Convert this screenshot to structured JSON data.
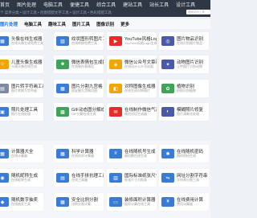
{
  "nav": {
    "menu": [
      "首页",
      "图片处理",
      "电脑工具",
      "便捷工具",
      "综合工具",
      "建站工具",
      "站长工具",
      "设计工具"
    ],
    "breadcrumbs": "个 菜单分类  • 设计工具  • 创意搭配文字工具 • 设计工具 • 色彩搭配工具",
    "search_placeholder": "搜索站内工具"
  },
  "tabs": [
    "图片处理",
    "电脑工具",
    "趣味工具",
    "图片工具",
    "图像识别",
    "更多"
  ],
  "row1": [
    {
      "title": "头像在线生成器",
      "desc": "在线头像生成免费工具",
      "color": "#3a7bd5",
      "icon": "▦"
    },
    {
      "title": "纹状图形转图片工具",
      "desc": "在线转换免费工具",
      "color": "#3a7bd5",
      "icon": "▧"
    },
    {
      "title": "YouTube风格Logo生成",
      "desc": "YouTube风格Logo生成",
      "color": "#e52d27",
      "icon": "▶"
    },
    {
      "title": "图片物品识别",
      "desc": "在线识别图片物品",
      "color": "#4a5aa8",
      "icon": "◎"
    }
  ],
  "row2": [
    {
      "title": "儿童头像生成器",
      "desc": "卡通头像在线生成",
      "color": "#f0a500",
      "icon": "☺"
    },
    {
      "title": "微信表情包生成器",
      "desc": "在线制作表情包",
      "color": "#3fa35a",
      "icon": "☻"
    },
    {
      "title": "微信公众号文章封面",
      "desc": "在线设计公众号封面",
      "color": "#f0a500",
      "icon": "◈"
    },
    {
      "title": "动物图片识别",
      "desc": "上传图片识别动物",
      "color": "#4a5aa8",
      "icon": "✦"
    }
  ],
  "row3": [
    {
      "title": "图片转字符画工具",
      "desc": "图片转换为字符画",
      "color": "#7d8aa0",
      "icon": "▤"
    },
    {
      "title": "图片分割九宫格",
      "desc": "朋友圈九宫格切图",
      "color": "#3a7bd5",
      "icon": "▦"
    },
    {
      "title": "对称图像生成器",
      "desc": "在线生成对称图片",
      "color": "#f0a500",
      "icon": "◧"
    },
    {
      "title": "植物识别",
      "desc": "拍照识别植物",
      "color": "#3fa35a",
      "icon": "✿"
    }
  ],
  "row4": [
    {
      "title": "照片处理工具",
      "desc": "照片在线处理",
      "color": "#3a7bd5",
      "icon": "▣"
    },
    {
      "title": "GIF动态图分解成静态",
      "desc": "GIF分解在线工具",
      "color": "#3fa35a",
      "icon": "▩"
    },
    {
      "title": "在线制作微信气泡图",
      "desc": "微信对话生成器",
      "color": "#e52d27",
      "icon": "✉"
    },
    {
      "title": "模糊照片修复",
      "desc": "照片清晰化处理",
      "color": "#4a5aa8",
      "icon": "◐"
    }
  ],
  "row5": [
    {
      "title": "计算器大全",
      "desc": "在线计算器",
      "color": "#3a7bd5",
      "icon": "▦"
    },
    {
      "title": "科学计算器",
      "desc": "在线科学计算器",
      "color": "#3a7bd5",
      "icon": "▦"
    },
    {
      "title": "在线随机号生成",
      "desc": "随机数在线生成",
      "color": "#3a7bd5",
      "icon": "#"
    },
    {
      "title": "在线随机密码",
      "desc": "随机密码生成",
      "color": "#3a7bd5",
      "icon": "✱"
    }
  ],
  "row6": [
    {
      "title": "随机昵称生成",
      "desc": "在线昵称生成",
      "color": "#3a7bd5",
      "icon": "◉"
    },
    {
      "title": "在线手拼抗理工具箱",
      "desc": "在线工具箱",
      "color": "#3a7bd5",
      "icon": "▤"
    },
    {
      "title": "国际标准纸张尺寸",
      "desc": "纸张尺寸对照表",
      "color": "#3a7bd5",
      "icon": "▥"
    },
    {
      "title": "网址分割字符串",
      "desc": "字符串分割工具",
      "color": "#3a7bd5",
      "icon": "⇋"
    }
  ],
  "row7": [
    {
      "title": "随机数字抽奖",
      "desc": "在线抽奖工具",
      "color": "#3a7bd5",
      "icon": "◆"
    },
    {
      "title": "安全比例分割",
      "desc": "比例分割计算",
      "color": "#3a7bd5",
      "icon": "▦"
    },
    {
      "title": "装修面积计算器",
      "desc": "面积计算在线工具",
      "color": "#3a7bd5",
      "icon": "▭"
    },
    {
      "title": "在线费用计算",
      "desc": "费用计算器",
      "color": "#3a7bd5",
      "icon": "¥"
    }
  ]
}
